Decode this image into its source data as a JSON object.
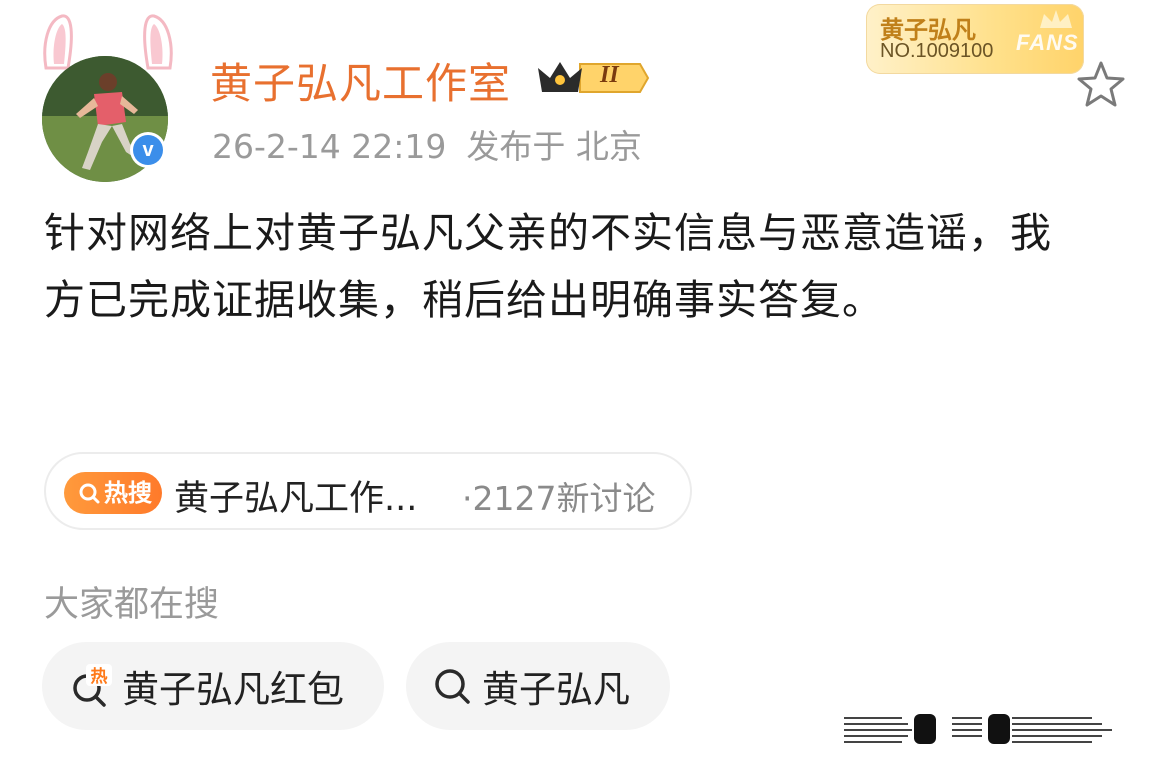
{
  "post": {
    "author": "黄子弘凡工作室",
    "level_badge": "II",
    "timestamp": "26-2-14 22:19",
    "location": "发布于 北京",
    "text": "针对网络上对黄子弘凡父亲的不实信息与恶意造谣，我方已完成证据收集，稍后给出明确事实答复。",
    "verified_mark": "v"
  },
  "fan_badge": {
    "name": "黄子弘凡",
    "number": "NO.1009100",
    "mark": "FANS"
  },
  "hot_topic": {
    "tag": "热搜",
    "title": "黄子弘凡工作...",
    "count": "·2127新讨论"
  },
  "related": {
    "heading": "大家都在搜",
    "items": [
      {
        "label": "黄子弘凡红包",
        "icon": "hot-search-icon"
      },
      {
        "label": "黄子弘凡",
        "icon": "search-icon"
      }
    ]
  },
  "colors": {
    "accent": "#e8702f",
    "meta_gray": "#9a9a9a",
    "hot_tag": "#ff8a30",
    "verified": "#3b8eea"
  }
}
